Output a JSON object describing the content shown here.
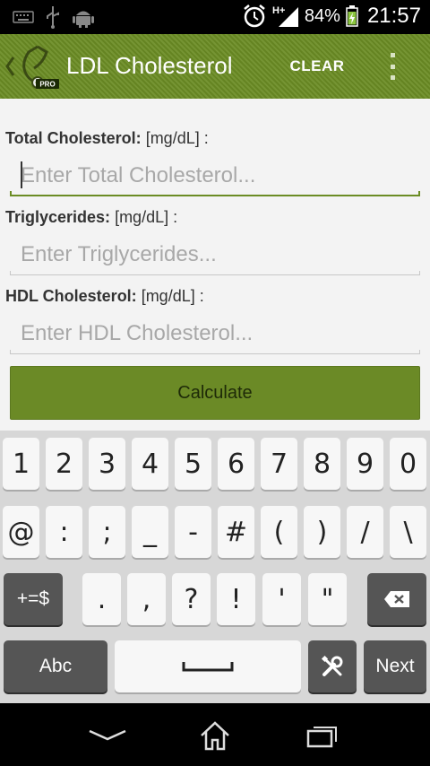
{
  "status_bar": {
    "icons": [
      "keyboard-icon",
      "usb-icon",
      "android-icon",
      "alarm-icon",
      "signal-h-plus-icon",
      "battery-charging-icon"
    ],
    "battery_percent": "84%",
    "time": "21:57"
  },
  "action_bar": {
    "title": "LDL Cholesterol",
    "logo_badge": "PRO",
    "clear_label": "CLEAR",
    "accent_color": "#6b8c24"
  },
  "form": {
    "total": {
      "label_bold": "Total Cholesterol:",
      "label_unit": " [mg/dL] :",
      "placeholder": "Enter Total Cholesterol...",
      "value": ""
    },
    "trig": {
      "label_bold": "Triglycerides:",
      "label_unit": " [mg/dL] :",
      "placeholder": "Enter Triglycerides...",
      "value": ""
    },
    "hdl": {
      "label_bold": "HDL Cholesterol:",
      "label_unit": " [mg/dL] :",
      "placeholder": "Enter HDL Cholesterol...",
      "value": ""
    },
    "calculate_label": "Calculate"
  },
  "keyboard": {
    "row1": [
      "1",
      "2",
      "3",
      "4",
      "5",
      "6",
      "7",
      "8",
      "9",
      "0"
    ],
    "row2": [
      "@",
      ":",
      ";",
      "_",
      "-",
      "#",
      "(",
      ")",
      "/",
      "\\"
    ],
    "row3_shift": "+=$",
    "row3": [
      ".",
      ",",
      "?",
      "!",
      "'",
      "\""
    ],
    "abc_label": "Abc",
    "next_label": "Next"
  },
  "nav_bar": {
    "icons": [
      "back-icon",
      "home-icon",
      "recent-apps-icon"
    ]
  }
}
